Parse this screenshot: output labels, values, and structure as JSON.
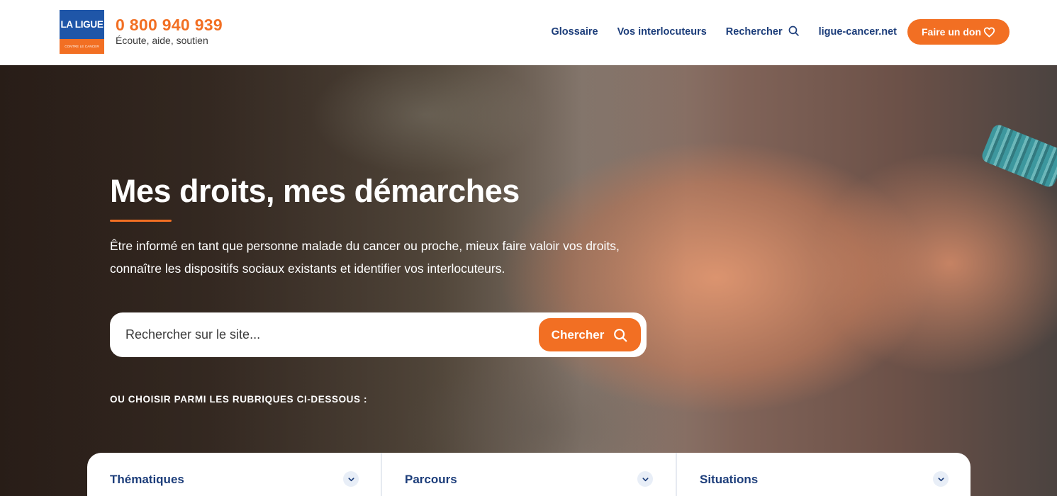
{
  "header": {
    "logo": {
      "top_text": "LA LIGUE",
      "bottom_text": "CONTRE LE CANCER"
    },
    "phone": "0 800 940 939",
    "tagline": "Écoute, aide, soutien",
    "nav": {
      "glossaire": "Glossaire",
      "interlocuteurs": "Vos interlocuteurs",
      "rechercher": "Rechercher",
      "site_link": "ligue-cancer.net",
      "donate": "Faire un don"
    }
  },
  "hero": {
    "title": "Mes droits, mes démarches",
    "description": "Être informé en tant que personne malade du cancer ou proche, mieux faire valoir vos droits, connaître les dispositifs sociaux existants et identifier vos interlocuteurs.",
    "search": {
      "placeholder": "Rechercher sur le site...",
      "button": "Chercher"
    },
    "choose_label": "OU CHOISIR PARMI LES RUBRIQUES CI-DESSOUS :"
  },
  "categories": [
    {
      "label": "Thématiques"
    },
    {
      "label": "Parcours"
    },
    {
      "label": "Situations"
    }
  ],
  "colors": {
    "accent": "#f26f23",
    "navy": "#1c3d7a",
    "logo_blue": "#1f56a8"
  },
  "icons": {
    "nav_search": "search-icon",
    "donate": "heart-icon",
    "search_button": "search-icon",
    "category_toggle": "chevron-down-icon"
  }
}
